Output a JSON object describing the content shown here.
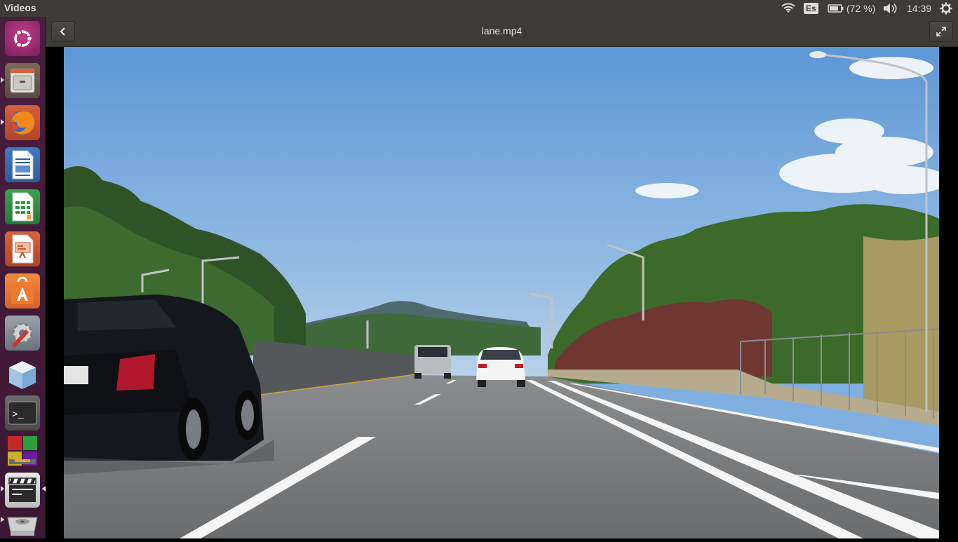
{
  "topbar": {
    "app_title": "Videos",
    "keyboard_layout": "Es",
    "battery": "(72 %)",
    "clock": "14:39",
    "icons": [
      "wifi-icon",
      "battery-icon",
      "volume-icon",
      "settings-gear-icon"
    ]
  },
  "launcher": {
    "items": [
      {
        "name": "ubuntu-dash",
        "icon": "ubuntu-logo-icon",
        "running": false
      },
      {
        "name": "files",
        "icon": "file-cabinet-icon",
        "running": true
      },
      {
        "name": "firefox",
        "icon": "firefox-icon",
        "running": true
      },
      {
        "name": "libreoffice-writer",
        "icon": "writer-icon",
        "running": false
      },
      {
        "name": "libreoffice-calc",
        "icon": "calc-icon",
        "running": false
      },
      {
        "name": "libreoffice-impress",
        "icon": "impress-icon",
        "running": false
      },
      {
        "name": "ubuntu-software",
        "icon": "software-bag-icon",
        "running": false
      },
      {
        "name": "system-settings",
        "icon": "settings-icon",
        "running": false
      },
      {
        "name": "cube-app",
        "icon": "cube-icon",
        "running": false
      },
      {
        "name": "terminal",
        "icon": "terminal-icon",
        "running": false
      },
      {
        "name": "color-app",
        "icon": "color-squares-icon",
        "running": false
      },
      {
        "name": "videos",
        "icon": "clapperboard-icon",
        "running": true
      },
      {
        "name": "disk",
        "icon": "disk-drive-icon",
        "running": true
      }
    ]
  },
  "header": {
    "title": "lane.mp4",
    "back_icon": "chevron-left-icon",
    "fullscreen_icon": "fullscreen-icon"
  },
  "colors": {
    "topbar_bg": "#3c3b37",
    "launcher_bg": "#4a1d3e",
    "header_bg": "#3c3b37"
  }
}
